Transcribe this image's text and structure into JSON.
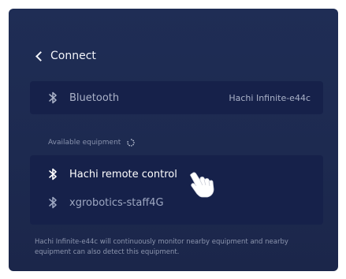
{
  "header": {
    "back_label": "Connect"
  },
  "bluetooth": {
    "label": "Bluetooth",
    "device_name": "Hachi Infinite-e44c",
    "icon": "bluetooth-icon"
  },
  "available": {
    "section_label": "Available equipment",
    "loading_icon": "loading-spinner-icon",
    "items": [
      {
        "label": "Hachi remote control",
        "icon": "bluetooth-icon",
        "state": "highlighted"
      },
      {
        "label": "xgrobotics-staff4G",
        "icon": "bluetooth-icon",
        "state": "normal"
      }
    ]
  },
  "footer": {
    "note": "Hachi Infinite-e44c will continuously monitor nearby equipment and nearby equipment can also detect this equipment."
  },
  "colors": {
    "background": "#1e2b52",
    "card": "#16214a",
    "text_primary": "#ffffff",
    "text_secondary": "#aab2c8"
  }
}
